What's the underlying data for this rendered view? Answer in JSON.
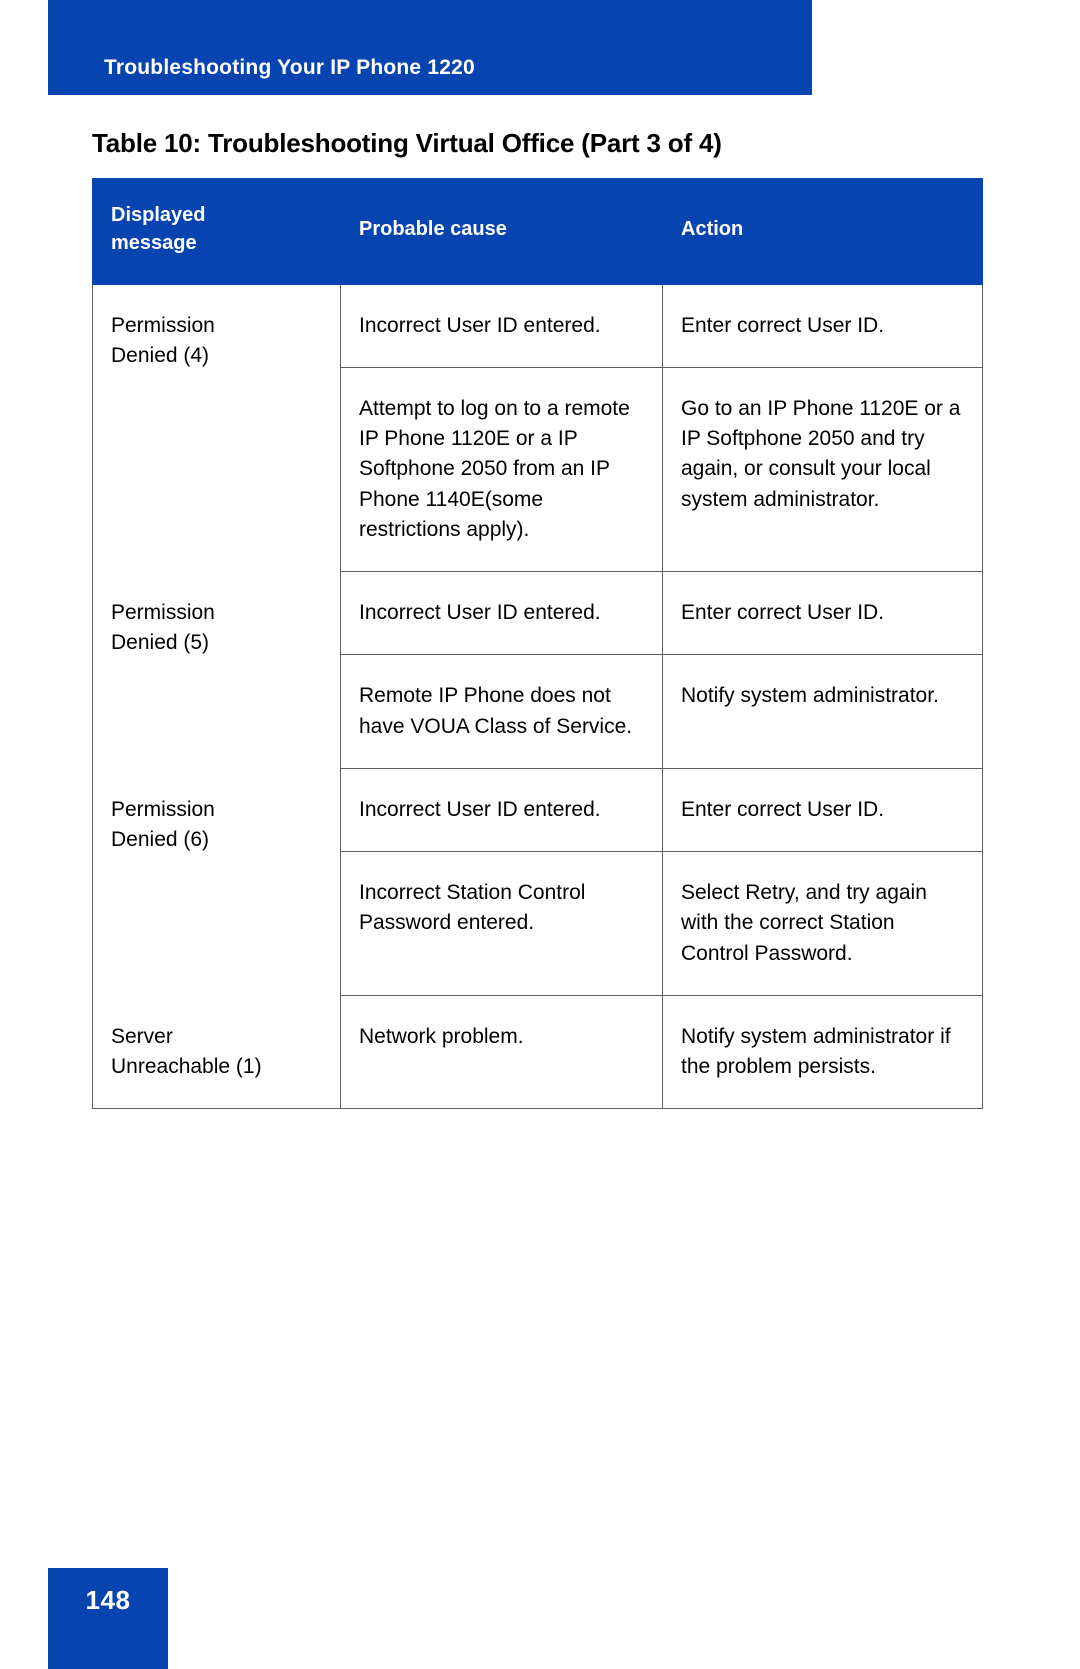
{
  "header": {
    "running_title": "Troubleshooting Your IP Phone 1220"
  },
  "caption": "Table 10: Troubleshooting Virtual Office (Part 3 of 4)",
  "table": {
    "columns": [
      "Displayed message",
      "Probable cause",
      "Action"
    ],
    "column_header_lines": {
      "col1_line1": "Displayed",
      "col1_line2": "message",
      "col2": "Probable cause",
      "col3": "Action"
    },
    "groups": [
      {
        "message": "Permission Denied (4)",
        "message_line1": "Permission",
        "message_line2": "Denied (4)",
        "rows": [
          {
            "cause": "Incorrect User ID entered.",
            "action": "Enter correct User ID."
          },
          {
            "cause": "Attempt to log on to a remote IP Phone 1120E or a IP Softphone 2050 from an IP Phone 1140E(some restrictions apply).",
            "action": "Go to an IP Phone 1120E or a IP Softphone 2050 and try again, or consult your local system administrator."
          }
        ]
      },
      {
        "message": "Permission Denied (5)",
        "message_line1": "Permission",
        "message_line2": "Denied (5)",
        "rows": [
          {
            "cause": "Incorrect User ID entered.",
            "action": "Enter correct User ID."
          },
          {
            "cause": "Remote IP Phone does not have VOUA Class of Service.",
            "action": "Notify system administrator."
          }
        ]
      },
      {
        "message": "Permission Denied (6)",
        "message_line1": "Permission",
        "message_line2": "Denied (6)",
        "rows": [
          {
            "cause": "Incorrect User ID entered.",
            "action": "Enter correct User ID."
          },
          {
            "cause": "Incorrect Station Control Password entered.",
            "action": "Select Retry, and try again with the correct Station Control Password."
          }
        ]
      },
      {
        "message": "Server Unreachable (1)",
        "message_line1": "Server",
        "message_line2": "Unreachable (1)",
        "rows": [
          {
            "cause": "Network problem.",
            "action": "Notify system administrator if the problem persists."
          }
        ]
      }
    ]
  },
  "footer": {
    "page_number": "148"
  },
  "colors": {
    "brand_blue": "#0844B0",
    "rule_gray": "#5e5e5e",
    "text_black": "#000000",
    "white": "#ffffff"
  }
}
